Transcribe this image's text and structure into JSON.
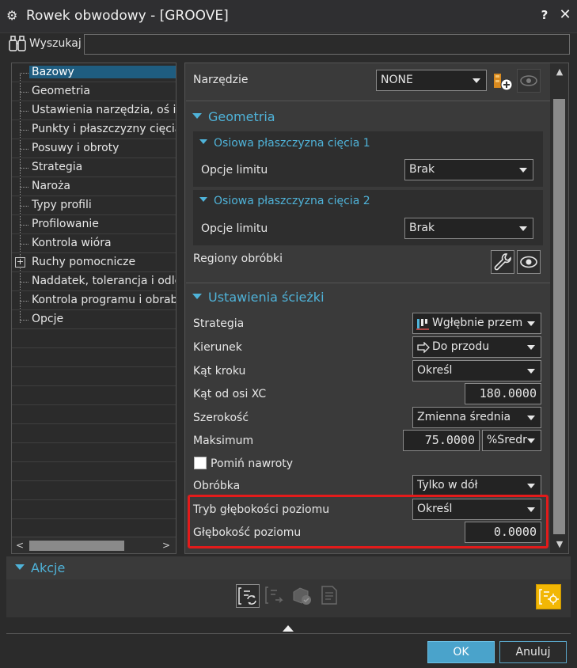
{
  "window": {
    "title": "Rowek obwodowy - [GROOVE]",
    "help_label": "?",
    "close_label": "✕"
  },
  "search": {
    "label": "Wyszukaj",
    "value": ""
  },
  "tree": {
    "items": [
      {
        "label": "Bazowy",
        "selected": true
      },
      {
        "label": "Geometria"
      },
      {
        "label": "Ustawienia narzędzia, oś i ko"
      },
      {
        "label": "Punkty i płaszczyzny cięcia"
      },
      {
        "label": "Posuwy i obroty"
      },
      {
        "label": "Strategia"
      },
      {
        "label": "Naroża"
      },
      {
        "label": "Typy profili"
      },
      {
        "label": "Profilowanie"
      },
      {
        "label": "Kontrola wióra"
      },
      {
        "label": "Ruchy pomocnicze",
        "expandable": true
      },
      {
        "label": "Naddatek, tolerancja i odleg"
      },
      {
        "label": "Kontrola programu i obrabi"
      },
      {
        "label": "Opcje"
      }
    ]
  },
  "tool": {
    "label": "Narzędzie",
    "value": "NONE"
  },
  "geometry": {
    "header": "Geometria",
    "plane1": {
      "header": "Osiowa płaszczyzna cięcia 1",
      "label": "Opcje limitu",
      "value": "Brak"
    },
    "plane2": {
      "header": "Osiowa płaszczyzna cięcia 2",
      "label": "Opcje limitu",
      "value": "Brak"
    },
    "regions_label": "Regiony obróbki"
  },
  "path": {
    "header": "Ustawienia ścieżki",
    "strategy": {
      "label": "Strategia",
      "value": "Wgłębnie przemi"
    },
    "direction": {
      "label": "Kierunek",
      "value": "Do przodu"
    },
    "step_angle": {
      "label": "Kąt kroku",
      "value": "Określ"
    },
    "angle_xc": {
      "label": "Kąt od osi XC",
      "value": "180.0000"
    },
    "width": {
      "label": "Szerokość",
      "value": "Zmienna średnia"
    },
    "maximum": {
      "label": "Maksimum",
      "value": "75.0000",
      "unit": "%Średr"
    },
    "skip_returns": {
      "label": "Pomiń nawroty",
      "checked": false
    },
    "machining": {
      "label": "Obróbka",
      "value": "Tylko w dół"
    },
    "level_depth_mode": {
      "label": "Tryb głębokości poziomu",
      "value": "Określ"
    },
    "level_depth": {
      "label": "Głębokość poziomu",
      "value": "0.0000"
    }
  },
  "actions": {
    "header": "Akcje"
  },
  "buttons": {
    "ok": "OK",
    "cancel": "Anuluj"
  },
  "colors": {
    "accent": "#4fb3d9",
    "highlight": "#e31b1b",
    "ok_button": "#4aa3cb"
  }
}
